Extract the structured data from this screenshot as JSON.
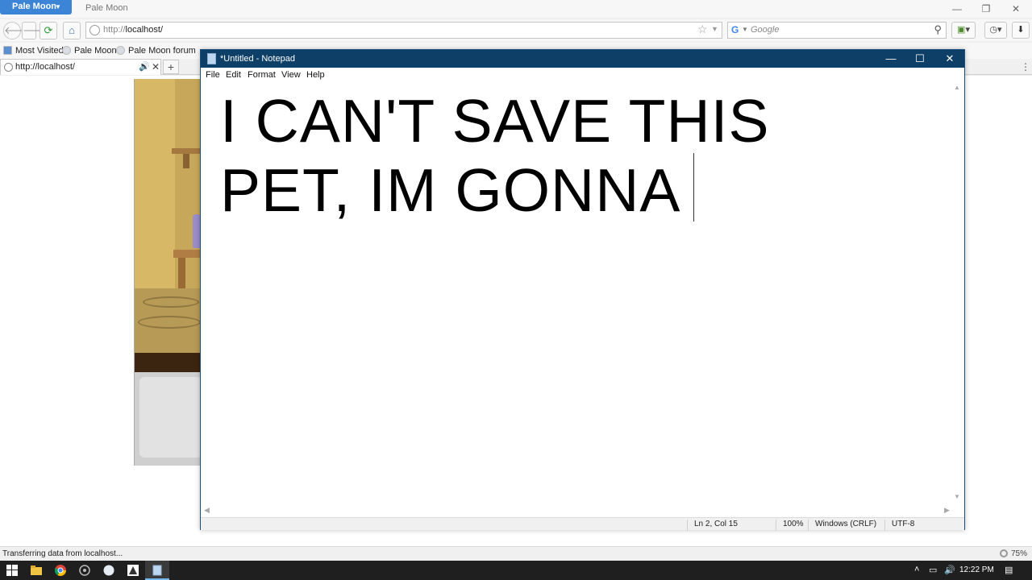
{
  "browser": {
    "app_menu_label": "Pale Moon",
    "window_title": "Pale Moon",
    "url_prefix": "http://",
    "url_host": "localhost/",
    "search_placeholder": "Google",
    "bookmarks": [
      "Most Visited",
      "Pale Moon",
      "Pale Moon forum"
    ],
    "tab": {
      "label": "http://localhost/"
    },
    "status_text": "Transferring data from localhost...",
    "zoom": "75%"
  },
  "notepad": {
    "title": "*Untitled - Notepad",
    "menu": [
      "File",
      "Edit",
      "Format",
      "View",
      "Help"
    ],
    "text": "I CAN'T SAVE THIS\nPET, IM GONNA ",
    "status": {
      "position": "Ln 2, Col 15",
      "zoom": "100%",
      "line_endings": "Windows (CRLF)",
      "encoding": "UTF-8"
    }
  },
  "taskbar": {
    "clock": "12:22 PM",
    "apps": [
      "start-icon",
      "file-explorer-icon",
      "chrome-icon",
      "app-icon",
      "pale-moon-icon",
      "inkscape-icon",
      "notepad-icon"
    ]
  },
  "colors": {
    "notepad_titlebar": "#0d3f67",
    "app_menu": "#3c84d6",
    "taskbar": "#1f1f1f"
  }
}
